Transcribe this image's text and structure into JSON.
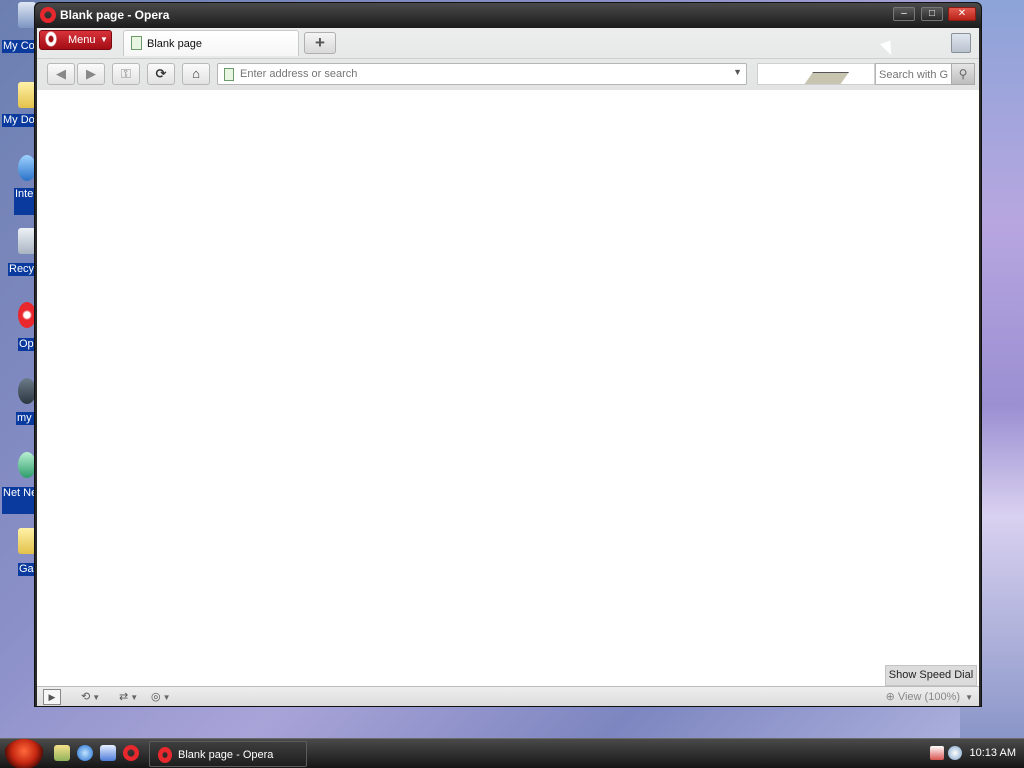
{
  "desktop": {
    "icons": [
      {
        "label": "My Co",
        "name": "my-computer"
      },
      {
        "label": "My Do",
        "name": "my-documents"
      },
      {
        "label": "Inte Exp",
        "name": "internet-explorer"
      },
      {
        "label": "Recy",
        "name": "recycle-bin"
      },
      {
        "label": "Op",
        "name": "opera"
      },
      {
        "label": "my",
        "name": "my"
      },
      {
        "label": "Net Neight",
        "name": "network-neighborhood"
      },
      {
        "label": "Ga",
        "name": "games"
      }
    ]
  },
  "window": {
    "title": "Blank page - Opera",
    "controls": {
      "minimize": "–",
      "maximize": "□",
      "close": "✕"
    }
  },
  "tabbar": {
    "menu_label": "Menu",
    "tabs": [
      {
        "label": "Blank page",
        "active": true
      }
    ],
    "new_tab_label": "+"
  },
  "toolbar": {
    "back": "◀",
    "forward": "▶",
    "key": "⚿",
    "reload": "⟳",
    "home": "⌂",
    "address_placeholder": "Enter address or search",
    "search_placeholder": "Search with G"
  },
  "content": {
    "speed_dial_label": "Show Speed Dial"
  },
  "statusbar": {
    "zoom_label": "View (100%)"
  },
  "taskbar": {
    "task_label": "Blank page - Opera",
    "clock": "10:13 AM"
  },
  "colors": {
    "opera_red": "#e8282d",
    "menu_red": "#b8141c",
    "desktop_label_bg": "#0b3a9e"
  }
}
